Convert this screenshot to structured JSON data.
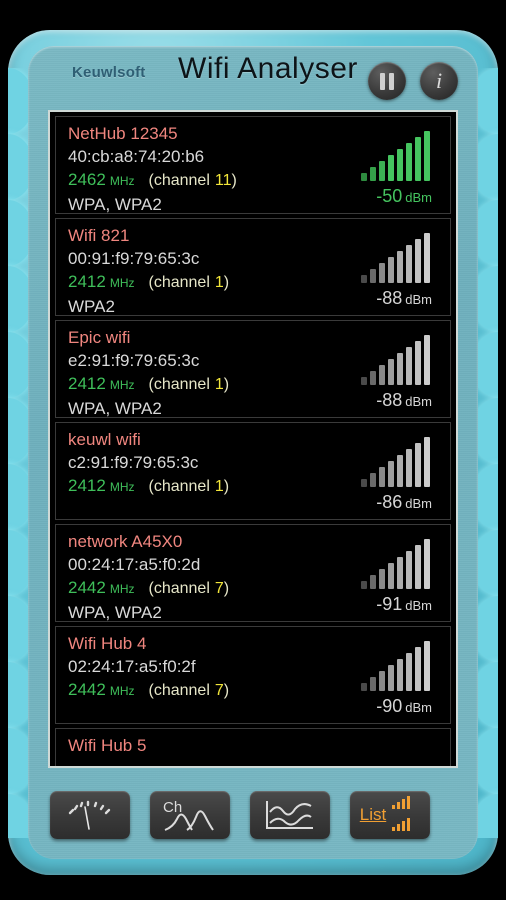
{
  "app": {
    "brand": "Keuwlsoft",
    "title": "Wifi Analyser",
    "pause_label": "pause-button",
    "info_label": "info-button"
  },
  "networks": [
    {
      "ssid": "NetHub 12345",
      "mac": "40:cb:a8:74:20:b6",
      "freq": "2462",
      "unit": "MHz",
      "channel_prefix": "(channel",
      "channel": "11",
      "channel_suffix": ")",
      "security": "WPA, WPA2",
      "signal": "-50",
      "signal_unit": "dBm",
      "strength": "strong"
    },
    {
      "ssid": "Wifi 821",
      "mac": "00:91:f9:79:65:3c",
      "freq": "2412",
      "unit": "MHz",
      "channel_prefix": "(channel",
      "channel": "1",
      "channel_suffix": ")",
      "security": "WPA2",
      "signal": "-88",
      "signal_unit": "dBm",
      "strength": "weak"
    },
    {
      "ssid": "Epic wifi",
      "mac": "e2:91:f9:79:65:3c",
      "freq": "2412",
      "unit": "MHz",
      "channel_prefix": "(channel",
      "channel": "1",
      "channel_suffix": ")",
      "security": "WPA, WPA2",
      "signal": "-88",
      "signal_unit": "dBm",
      "strength": "weak"
    },
    {
      "ssid": "keuwl wifi",
      "mac": "c2:91:f9:79:65:3c",
      "freq": "2412",
      "unit": "MHz",
      "channel_prefix": "(channel",
      "channel": "1",
      "channel_suffix": ")",
      "security": "",
      "signal": "-86",
      "signal_unit": "dBm",
      "strength": "weak"
    },
    {
      "ssid": "network A45X0",
      "mac": "00:24:17:a5:f0:2d",
      "freq": "2442",
      "unit": "MHz",
      "channel_prefix": "(channel",
      "channel": "7",
      "channel_suffix": ")",
      "security": "WPA, WPA2",
      "signal": "-91",
      "signal_unit": "dBm",
      "strength": "weak"
    },
    {
      "ssid": "Wifi Hub 4",
      "mac": "02:24:17:a5:f0:2f",
      "freq": "2442",
      "unit": "MHz",
      "channel_prefix": "(channel",
      "channel": "7",
      "channel_suffix": ")",
      "security": "",
      "signal": "-90",
      "signal_unit": "dBm",
      "strength": "weak"
    },
    {
      "ssid": "Wifi Hub 5",
      "mac": "",
      "freq": "",
      "unit": "",
      "channel_prefix": "",
      "channel": "",
      "channel_suffix": "",
      "security": "",
      "signal": "",
      "signal_unit": "",
      "strength": "weak"
    }
  ],
  "toolbar": {
    "signal_meter": "signal-meter-icon",
    "channel_graph": "channel-graph-icon",
    "channel_label": "Ch",
    "time_graph": "time-graph-icon",
    "list_label": "List"
  },
  "colors": {
    "bezel": "#63c6d8",
    "ssid": "#f0867f",
    "freq": "#3fbf5a",
    "channel": "#f2e63a",
    "accent_orange": "#f2a033"
  }
}
